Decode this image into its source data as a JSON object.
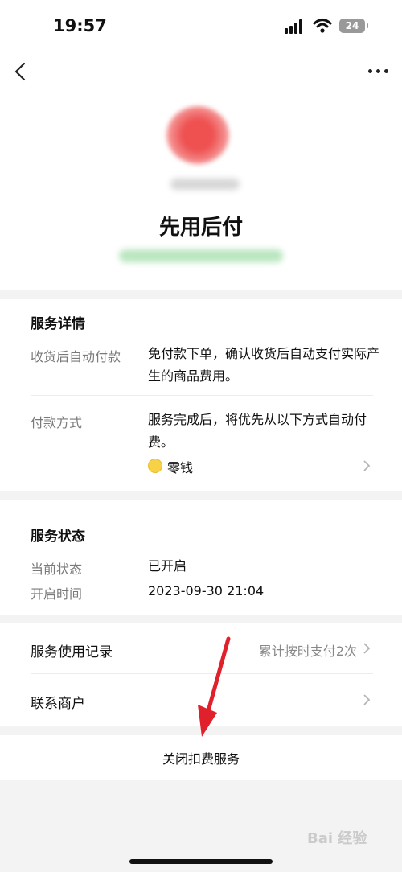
{
  "status_bar": {
    "time": "19:57",
    "battery": "24"
  },
  "header": {
    "service_title": "先用后付"
  },
  "service_details": {
    "title": "服务详情",
    "auto_pay": {
      "label": "收货后自动付款",
      "value": "免付款下单，确认收货后自动支付实际产生的商品费用。"
    },
    "payment_method": {
      "label": "付款方式",
      "value": "服务完成后，将优先从以下方式自动付费。",
      "method": "零钱"
    }
  },
  "service_status": {
    "title": "服务状态",
    "current_status": {
      "label": "当前状态",
      "value": "已开启"
    },
    "start_time": {
      "label": "开启时间",
      "value": "2023-09-30 21:04"
    }
  },
  "links": {
    "usage_record": {
      "label": "服务使用记录",
      "value": "累计按时支付2次"
    },
    "contact_merchant": {
      "label": "联系商户"
    }
  },
  "close_service": {
    "label": "关闭扣费服务"
  },
  "colors": {
    "annotation_arrow": "#e0202a",
    "coin": "#f7d247",
    "background": "#f3f3f3"
  },
  "watermark": "Bai 经验"
}
